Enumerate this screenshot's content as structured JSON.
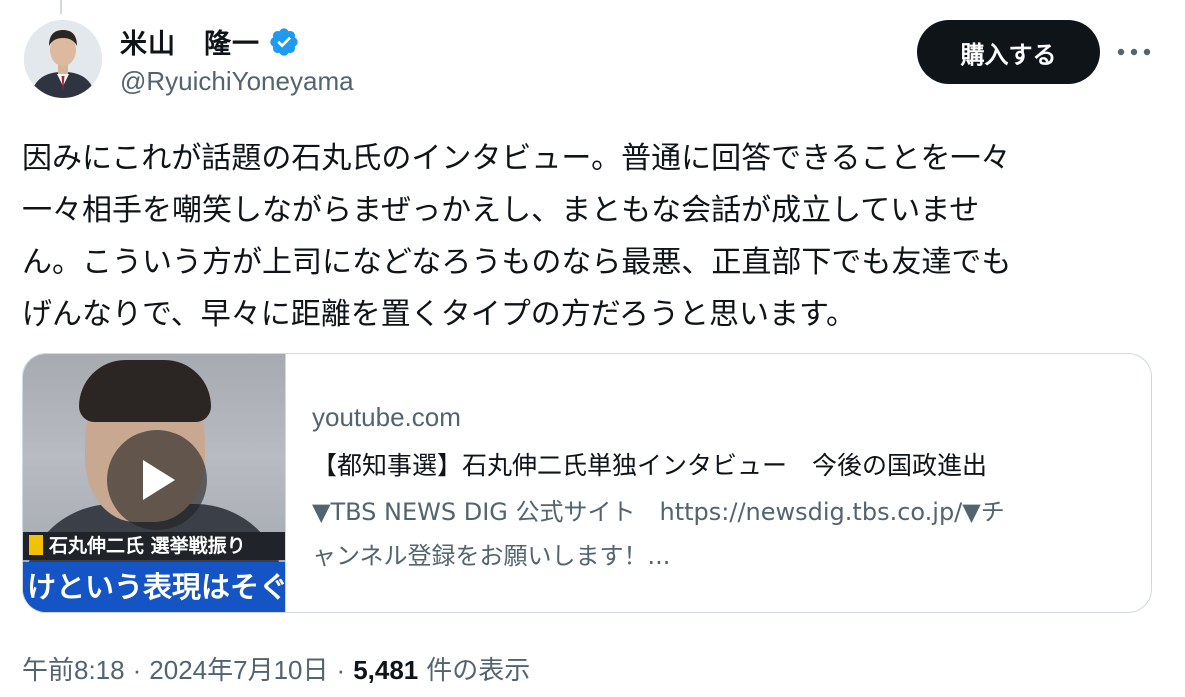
{
  "author": {
    "display_name": "米山　隆一",
    "handle": "@RyuichiYoneyama",
    "verified_icon": "verified-badge-icon"
  },
  "actions": {
    "buy_label": "購入する",
    "more_icon": "more-options-icon"
  },
  "tweet": {
    "text_lines": [
      "因みにこれが話題の石丸氏のインタビュー。普通に回答できることを一々",
      "一々相手を嘲笑しながらまぜっかえし、まともな会話が成立していませ",
      "ん。こういう方が上司になどなろうものなら最悪、正直部下でも友達でも",
      "げんなりで、早々に距離を置くタイプの方だろうと思います。"
    ]
  },
  "link_card": {
    "domain": "youtube.com",
    "title": "【都知事選】石丸伸二氏単独インタビュー　今後の国政進出",
    "description_lines": [
      "▼TBS NEWS DIG 公式サイト　https://newsdig.tbs.co.jp/▼チ",
      "ャンネル登録をお願いします！..."
    ],
    "thumbnail": {
      "caption_top": "石丸伸二氏 選挙戦振り",
      "caption_bottom": "けという表現はそぐわ",
      "play_icon": "play-icon"
    }
  },
  "meta": {
    "time": "午前8:18",
    "date": "2024年7月10日",
    "separator": "·",
    "views_count": "5,481",
    "views_label": "件の表示"
  },
  "colors": {
    "text_primary": "#0f1419",
    "text_secondary": "#536471",
    "verified_blue": "#1d9bf0",
    "border": "#cfd9de",
    "button_bg": "#0f1419"
  }
}
